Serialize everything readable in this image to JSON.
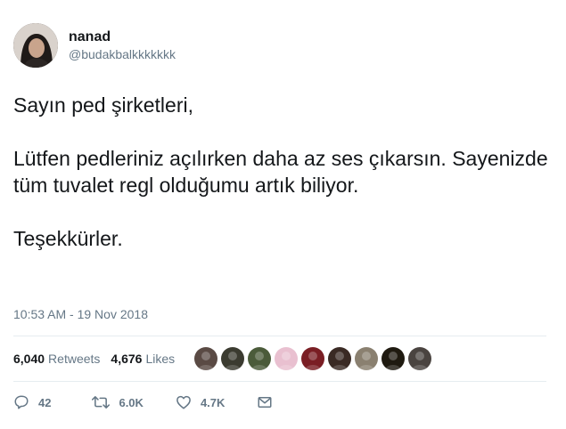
{
  "user": {
    "display_name": "nanad",
    "handle": "@budakbalkkkkkkk"
  },
  "tweet": {
    "paragraphs": [
      "Sayın ped şirketleri,",
      "Lütfen pedleriniz açılırken daha az ses çıkarsın. Sayenizde tüm tuvalet regl olduğumu artık biliyor.",
      "Teşekkürler."
    ],
    "timestamp": "10:53 AM - 19 Nov 2018"
  },
  "stats": {
    "retweets_count": "6,040",
    "retweets_label": "Retweets",
    "likes_count": "4,676",
    "likes_label": "Likes"
  },
  "liker_avatars": [
    {
      "color": "#5a4a44"
    },
    {
      "color": "#3b3b30"
    },
    {
      "color": "#4b5b3a"
    },
    {
      "color": "#e9c0d0"
    },
    {
      "color": "#7a1e24"
    },
    {
      "color": "#3a2a24"
    },
    {
      "color": "#8a8070"
    },
    {
      "color": "#1f1a10"
    },
    {
      "color": "#4a4440"
    }
  ],
  "actions": {
    "reply_count": "42",
    "retweet_count": "6.0K",
    "like_count": "4.7K"
  },
  "icons": {
    "reply": "reply-icon",
    "retweet": "retweet-icon",
    "like": "heart-icon",
    "message": "envelope-icon"
  }
}
